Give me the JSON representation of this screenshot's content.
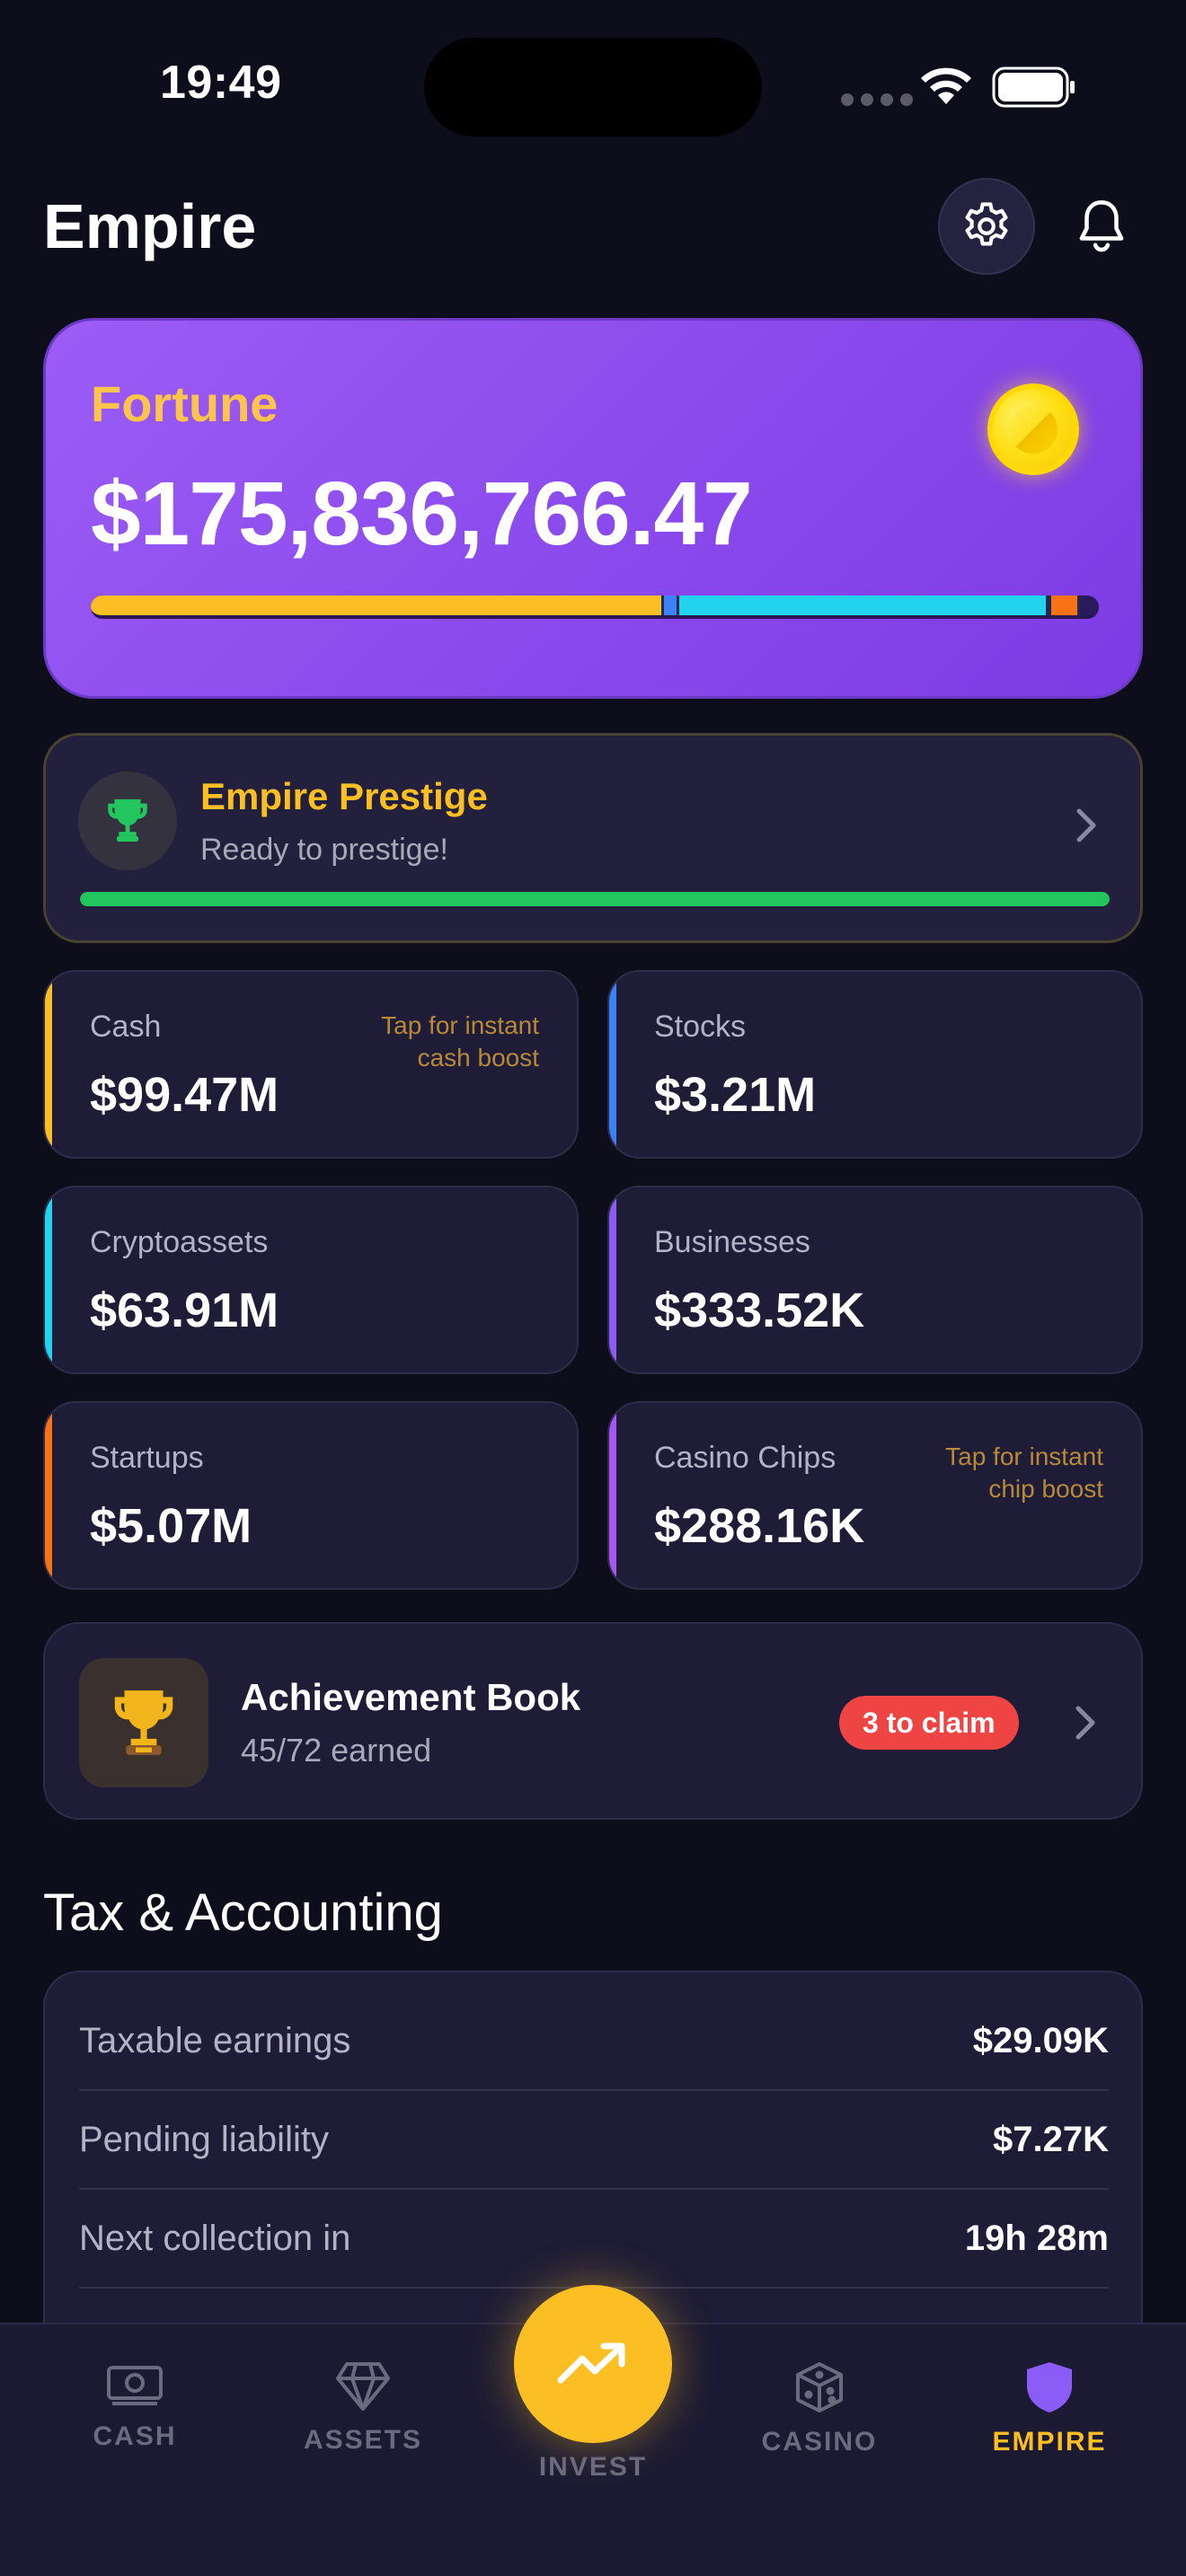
{
  "status_bar": {
    "time": "19:49"
  },
  "header": {
    "title": "Empire"
  },
  "fortune": {
    "label": "Fortune",
    "value": "$175,836,766.47",
    "allocation": [
      {
        "name": "Cash",
        "share": 0.566,
        "color": "#fbbf24"
      },
      {
        "name": "Stocks",
        "share": 0.018,
        "color": "#3b82f6"
      },
      {
        "name": "Cryptoassets",
        "share": 0.363,
        "color": "#22d3ee"
      },
      {
        "name": "Businesses",
        "share": 0.002,
        "color": "#8b5cf6"
      },
      {
        "name": "Startups",
        "share": 0.029,
        "color": "#f97316"
      },
      {
        "name": "Casino Chips",
        "share": 0.002,
        "color": "#d946ef"
      }
    ]
  },
  "prestige": {
    "title": "Empire Prestige",
    "subtitle": "Ready to prestige!",
    "progress": 1.0
  },
  "assets": [
    {
      "label": "Cash",
      "value": "$99.47M",
      "hint": "Tap for instant cash boost",
      "accent": "#fbbf24"
    },
    {
      "label": "Stocks",
      "value": "$3.21M",
      "hint": "",
      "accent": "#3b82f6"
    },
    {
      "label": "Cryptoassets",
      "value": "$63.91M",
      "hint": "",
      "accent": "#22d3ee"
    },
    {
      "label": "Businesses",
      "value": "$333.52K",
      "hint": "",
      "accent": "#8b5cf6"
    },
    {
      "label": "Startups",
      "value": "$5.07M",
      "hint": "",
      "accent": "#f97316"
    },
    {
      "label": "Casino Chips",
      "value": "$288.16K",
      "hint": "Tap for instant chip boost",
      "accent": "#a855f7"
    }
  ],
  "achievement": {
    "title": "Achievement Book",
    "subtitle": "45/72 earned",
    "badge": "3 to claim",
    "icon": "trophy-icon"
  },
  "tax": {
    "title": "Tax & Accounting",
    "rows": [
      {
        "key": "Taxable earnings",
        "value": "$29.09K"
      },
      {
        "key": "Pending liability",
        "value": "$7.27K"
      },
      {
        "key": "Next collection in",
        "value": "19h 28m"
      }
    ]
  },
  "tabbar": {
    "tabs": [
      {
        "label": "CASH",
        "icon": "cash-icon"
      },
      {
        "label": "ASSETS",
        "icon": "diamond-icon"
      },
      {
        "label": "INVEST",
        "icon": "trending-up-icon"
      },
      {
        "label": "CASINO",
        "icon": "dice-icon"
      },
      {
        "label": "EMPIRE",
        "icon": "shield-icon"
      }
    ],
    "active": "EMPIRE",
    "accent": "#fbbf24"
  }
}
